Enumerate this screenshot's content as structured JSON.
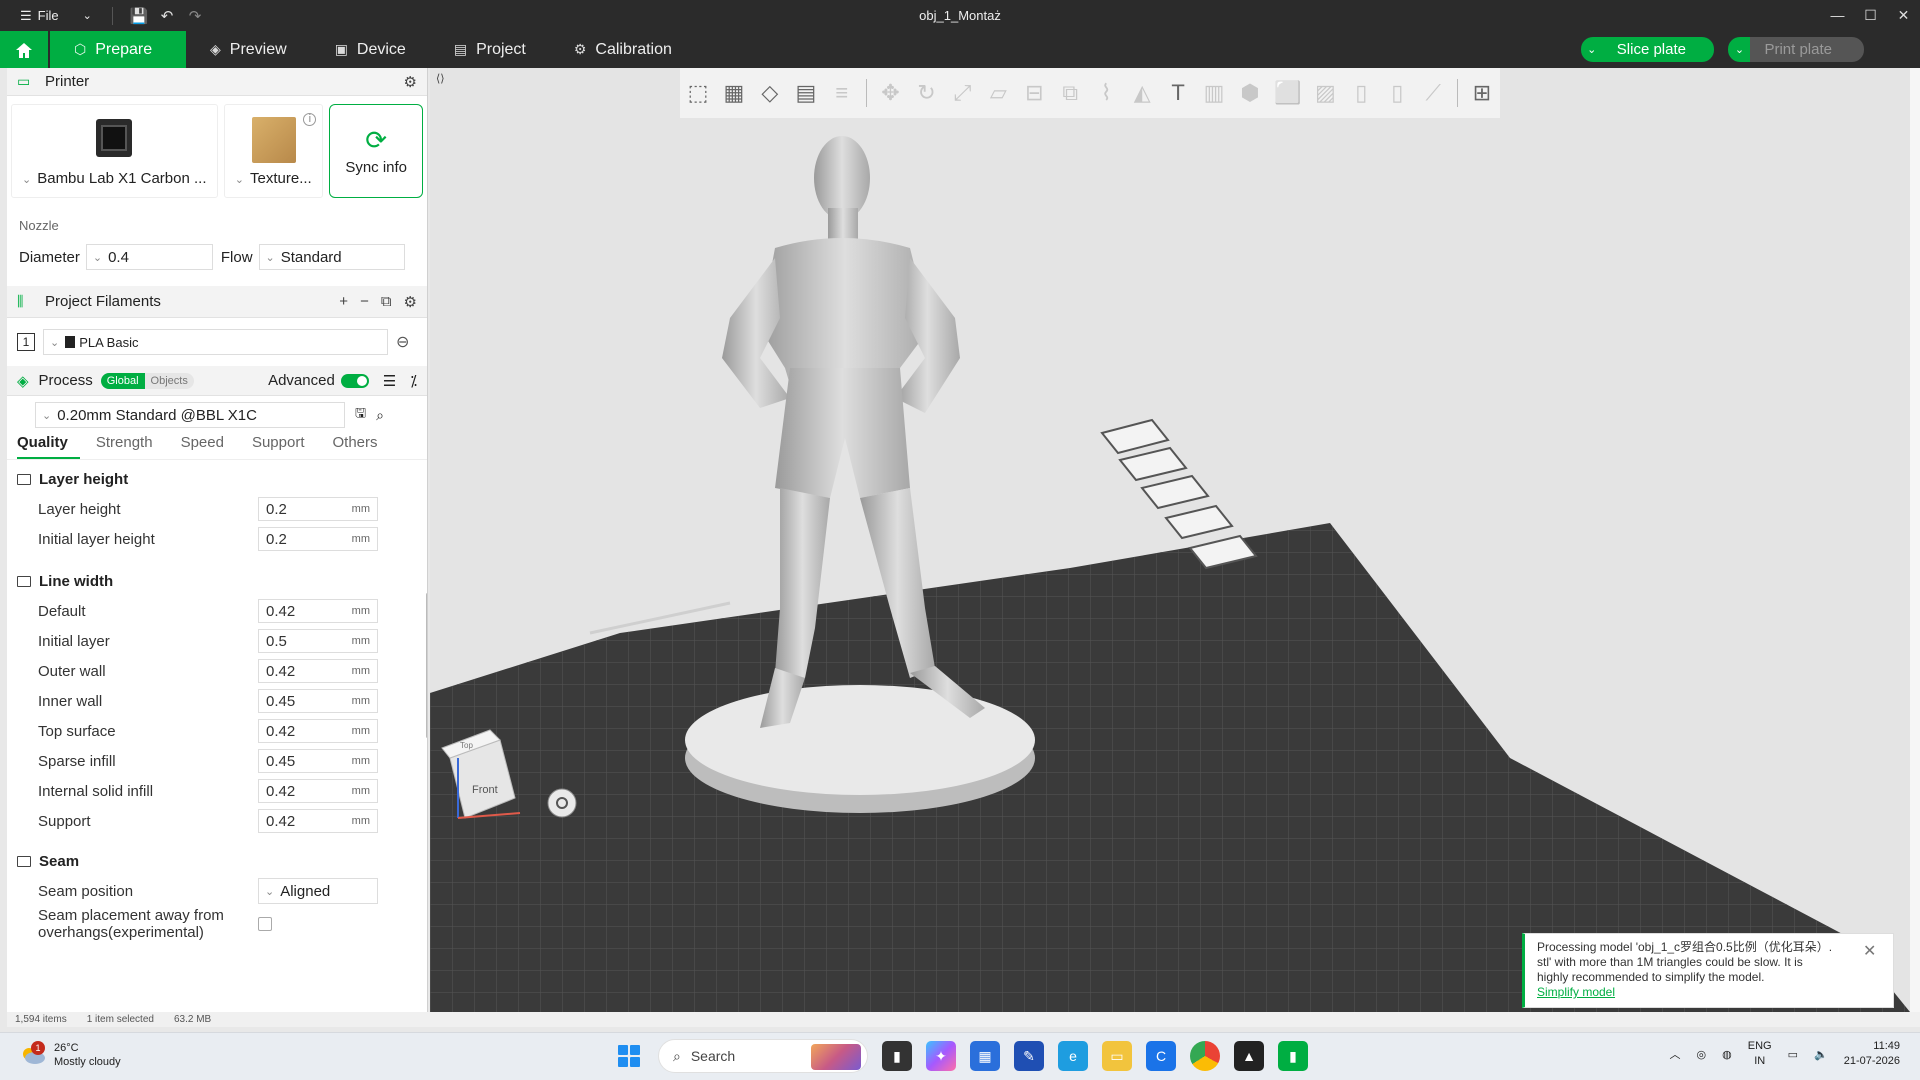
{
  "window": {
    "file_label": "File",
    "title": "obj_1_Montaż",
    "controls": [
      "—",
      "☐",
      "✕"
    ]
  },
  "nav": {
    "tabs": [
      {
        "label": "Prepare",
        "icon": "cube-icon"
      },
      {
        "label": "Preview",
        "icon": "layers-icon"
      },
      {
        "label": "Device",
        "icon": "device-icon"
      },
      {
        "label": "Project",
        "icon": "project-icon"
      },
      {
        "label": "Calibration",
        "icon": "gear-icon"
      }
    ],
    "slice_label": "Slice plate",
    "print_label": "Print plate"
  },
  "printer": {
    "section_title": "Printer",
    "printer_name": "Bambu Lab X1 Carbon ...",
    "plate_name": "Texture...",
    "sync_label": "Sync info",
    "nozzle_label": "Nozzle",
    "diameter_label": "Diameter",
    "diameter_value": "0.4",
    "flow_label": "Flow",
    "flow_value": "Standard"
  },
  "filaments": {
    "section_title": "Project Filaments",
    "items": [
      {
        "index": "1",
        "name": "PLA Basic"
      }
    ]
  },
  "process": {
    "section_title": "Process",
    "seg_global": "Global",
    "seg_objects": "Objects",
    "advanced_label": "Advanced",
    "preset": "0.20mm Standard @BBL X1C",
    "tabs": [
      "Quality",
      "Strength",
      "Speed",
      "Support",
      "Others"
    ],
    "layer_height_title": "Layer height",
    "layer_height": [
      {
        "label": "Layer height",
        "value": "0.2",
        "unit": "mm"
      },
      {
        "label": "Initial layer height",
        "value": "0.2",
        "unit": "mm"
      }
    ],
    "line_width_title": "Line width",
    "line_width": [
      {
        "label": "Default",
        "value": "0.42",
        "unit": "mm"
      },
      {
        "label": "Initial layer",
        "value": "0.5",
        "unit": "mm"
      },
      {
        "label": "Outer wall",
        "value": "0.42",
        "unit": "mm"
      },
      {
        "label": "Inner wall",
        "value": "0.45",
        "unit": "mm"
      },
      {
        "label": "Top surface",
        "value": "0.42",
        "unit": "mm"
      },
      {
        "label": "Sparse infill",
        "value": "0.45",
        "unit": "mm"
      },
      {
        "label": "Internal solid infill",
        "value": "0.42",
        "unit": "mm"
      },
      {
        "label": "Support",
        "value": "0.42",
        "unit": "mm"
      }
    ],
    "seam_title": "Seam",
    "seam_position_label": "Seam position",
    "seam_position_value": "Aligned",
    "seam_overhang_label_1": "Seam placement away from",
    "seam_overhang_label_2": "overhangs(experimental)"
  },
  "status": {
    "items": "1,594 items",
    "selected": "1 item selected",
    "size": "63.2 MB"
  },
  "viewport": {
    "cube_front": "Front",
    "cube_top": "Top"
  },
  "notification": {
    "line1": "Processing model 'obj_1_c罗组合0.5比例（优化耳朵）.",
    "line2": "stl' with more than 1M triangles could be slow. It is",
    "line3": "highly recommended to simplify the model.",
    "link": "Simplify model"
  },
  "taskbar": {
    "weather_temp": "26°C",
    "weather_desc": "Mostly cloudy",
    "weather_badge": "1",
    "search_placeholder": "Search",
    "lang1": "ENG",
    "lang2": "IN",
    "time": "11:49",
    "date": "21-07-2026"
  },
  "colors": {
    "accent": "#00ae42",
    "titlebar": "#2b2b2b",
    "bed": "#3c3c3c"
  }
}
